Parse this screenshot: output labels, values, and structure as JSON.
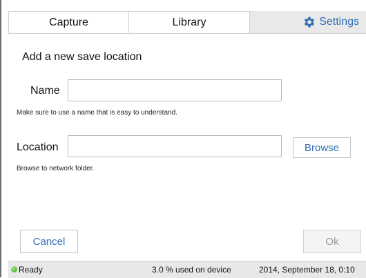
{
  "tabs": {
    "capture": "Capture",
    "library": "Library",
    "settings": "Settings",
    "settings_icon": "gear-icon",
    "accent_color": "#2f6fb5"
  },
  "form": {
    "heading": "Add a new save location",
    "name_label": "Name",
    "name_value": "",
    "name_hint": "Make sure to use a name that is easy to understand.",
    "location_label": "Location",
    "location_value": "",
    "location_hint": "Browse to network folder.",
    "browse_label": "Browse"
  },
  "actions": {
    "cancel_label": "Cancel",
    "ok_label": "Ok"
  },
  "status": {
    "state": "Ready",
    "state_color": "#3a9e20",
    "usage": "3.0 % used on device",
    "datetime": "2014, September 18, 0:10"
  }
}
